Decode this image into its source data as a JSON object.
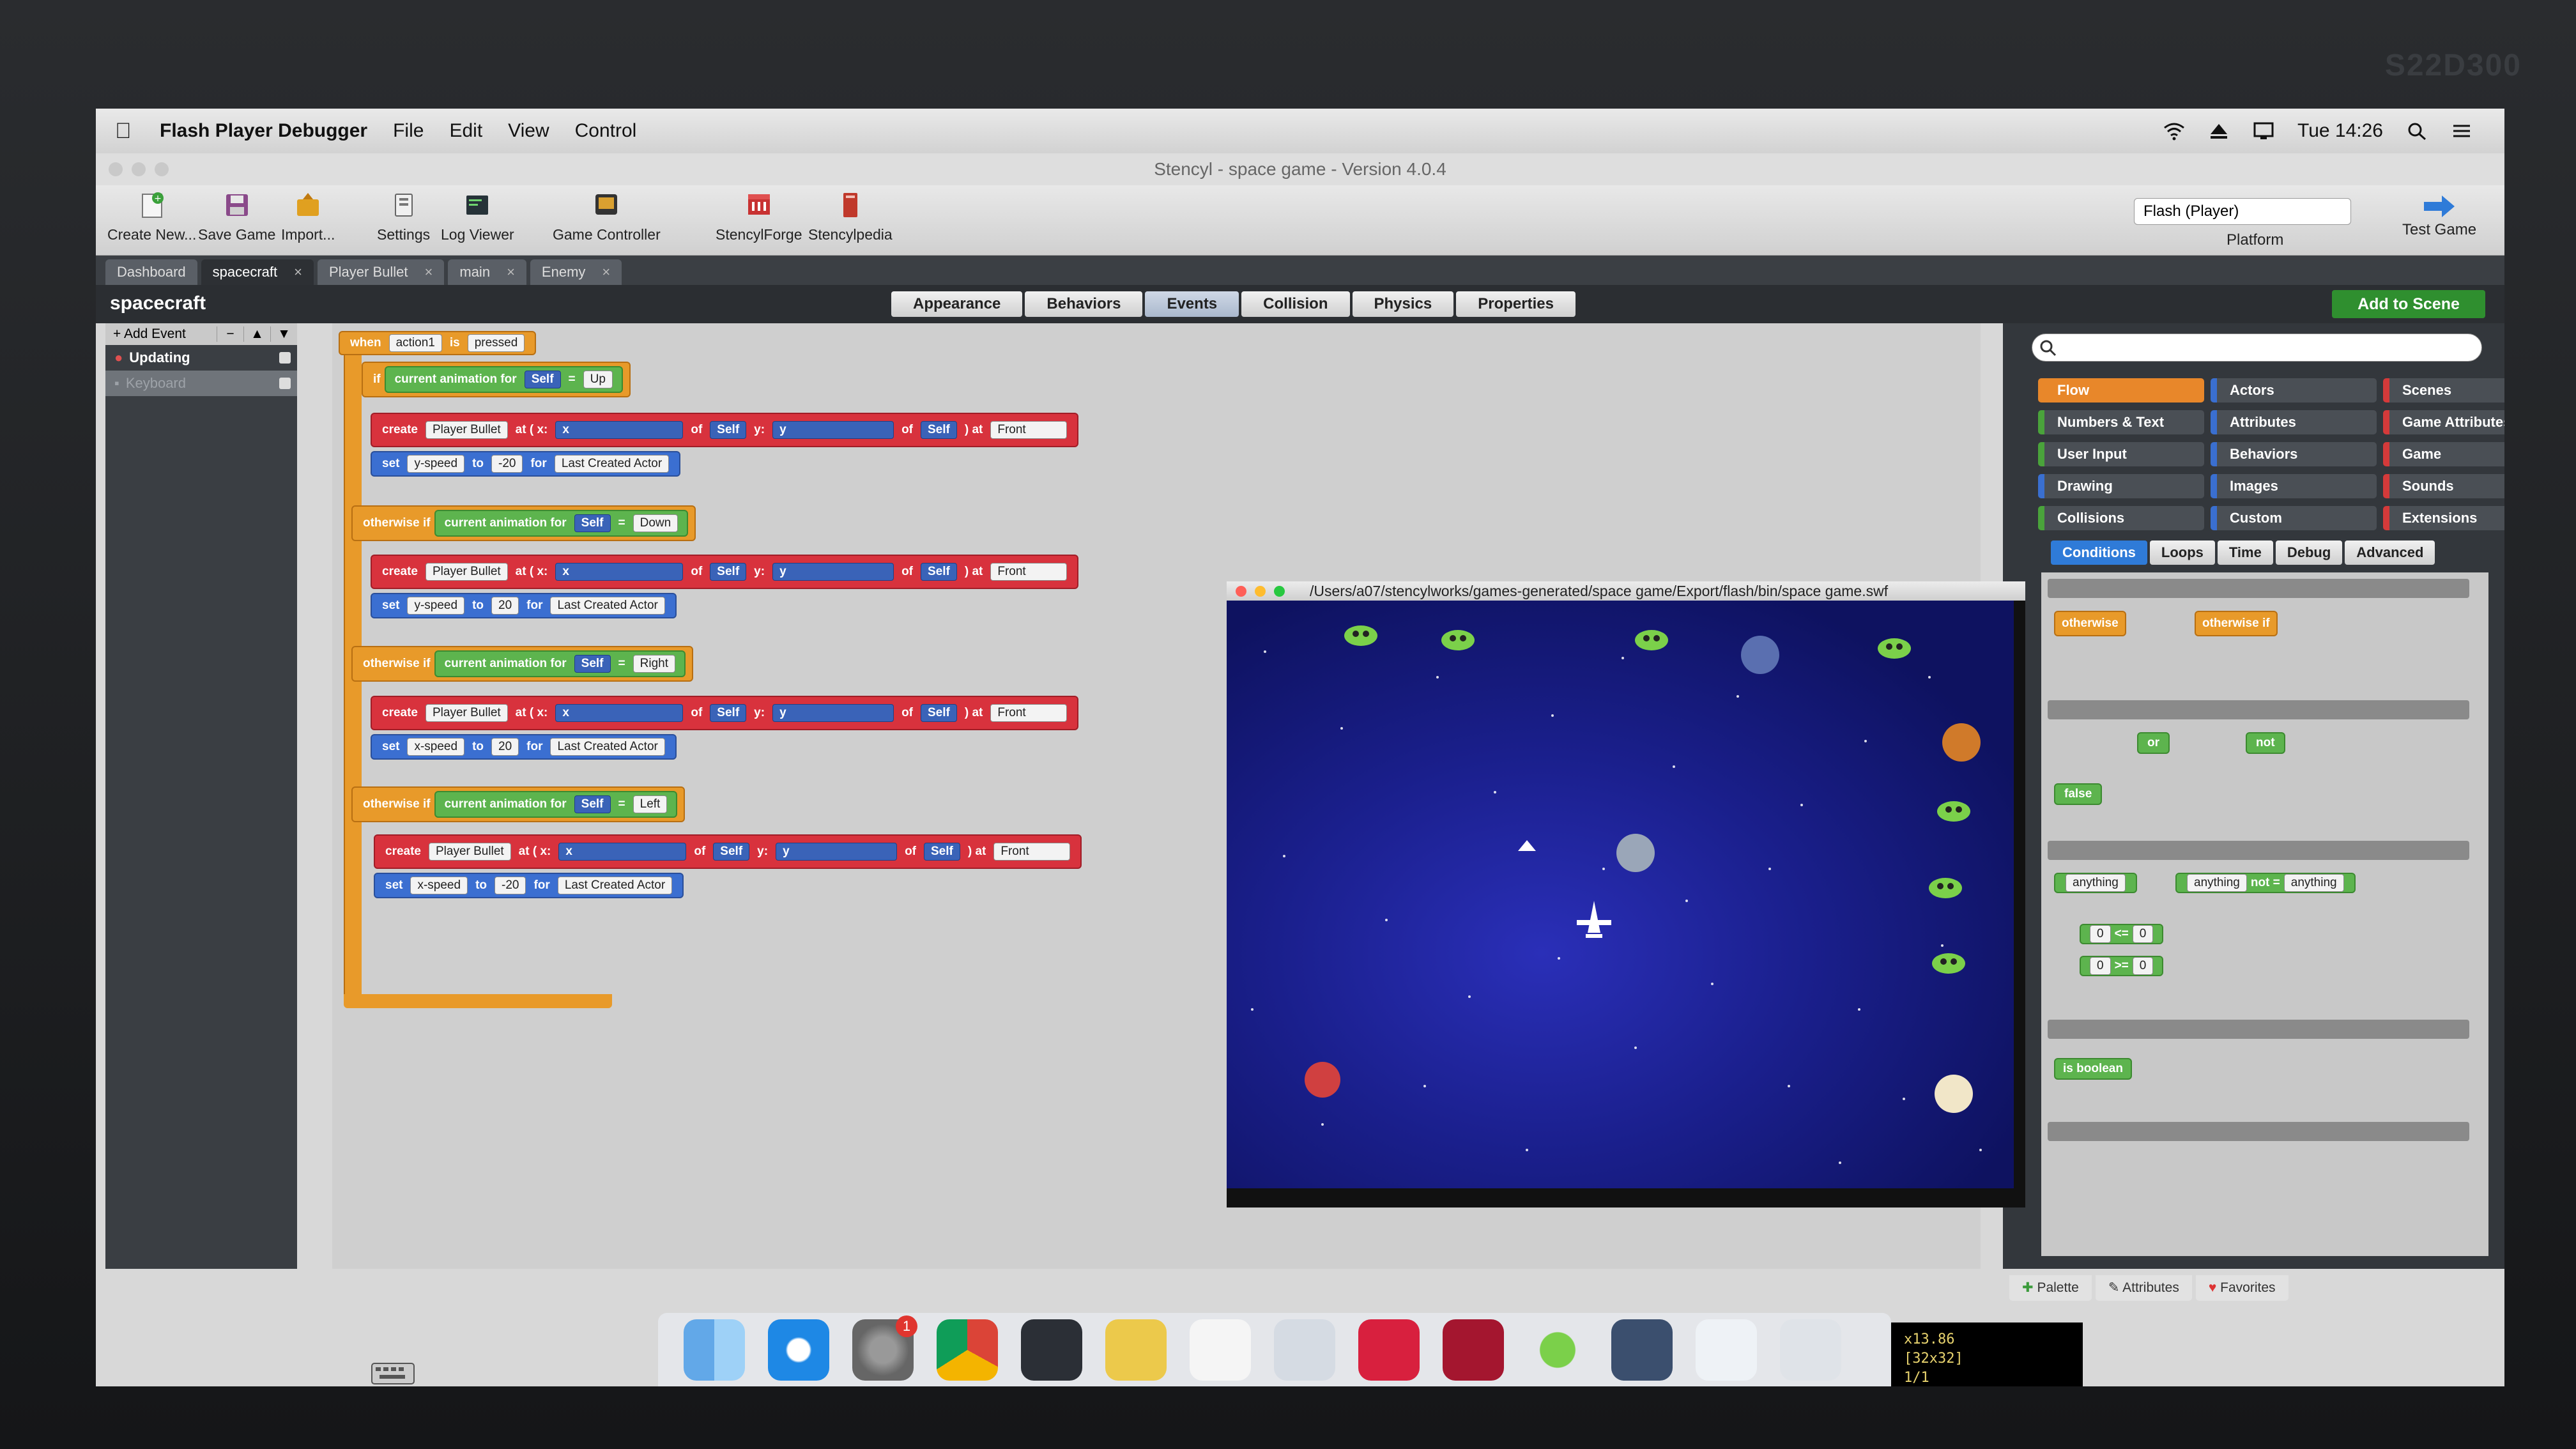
{
  "menubar": {
    "app_name": "Flash Player Debugger",
    "menus": [
      "File",
      "Edit",
      "View",
      "Control"
    ],
    "clock": "Tue 14:26"
  },
  "window": {
    "title": "Stencyl - space game - Version 4.0.4"
  },
  "toolbar": {
    "buttons": [
      {
        "label": "Create New...",
        "icon": "create-new-icon"
      },
      {
        "label": "Save Game",
        "icon": "save-icon"
      },
      {
        "label": "Import...",
        "icon": "import-icon"
      },
      {
        "label": "Settings",
        "icon": "settings-icon"
      },
      {
        "label": "Log Viewer",
        "icon": "log-viewer-icon"
      },
      {
        "label": "Game Controller",
        "icon": "game-controller-icon"
      },
      {
        "label": "StencylForge",
        "icon": "stencylforge-icon"
      },
      {
        "label": "Stencylpedia",
        "icon": "stencylpedia-icon"
      }
    ],
    "platform_value": "Flash (Player)",
    "platform_label": "Platform",
    "test_game": "Test Game"
  },
  "tabs": [
    {
      "label": "Dashboard",
      "closable": false
    },
    {
      "label": "spacecraft",
      "closable": true,
      "active": true
    },
    {
      "label": "Player Bullet",
      "closable": true
    },
    {
      "label": "main",
      "closable": true
    },
    {
      "label": "Enemy",
      "closable": true
    }
  ],
  "editor": {
    "title": "spacecraft",
    "mode_tabs": [
      "Appearance",
      "Behaviors",
      "Events",
      "Collision",
      "Physics",
      "Properties"
    ],
    "active_mode": "Events",
    "add_to_scene": "Add to Scene"
  },
  "events_panel": {
    "add_event": "+ Add Event",
    "items": [
      {
        "label": "Updating"
      },
      {
        "label": "Keyboard"
      }
    ]
  },
  "blocks": {
    "when": "when",
    "action": "action1",
    "is": "is",
    "pressed": "pressed",
    "if": "if",
    "otherwise_if": "otherwise if",
    "current_animation_for": "current animation for",
    "self": "Self",
    "eq": "=",
    "create": "create",
    "player_bullet": "Player Bullet",
    "at_x": "at ( x:",
    "x": "x",
    "of": "of",
    "y_colon": "y:",
    "y": "y",
    "at_front": ") at",
    "front": "Front",
    "set": "set",
    "to": "to",
    "for": "for",
    "last_created_actor": "Last Created Actor",
    "y_speed": "y-speed",
    "x_speed": "x-speed",
    "branches": [
      {
        "anim": "Up",
        "speed_prop": "y-speed",
        "speed": "-20"
      },
      {
        "anim": "Down",
        "speed_prop": "y-speed",
        "speed": "20"
      },
      {
        "anim": "Right",
        "speed_prop": "x-speed",
        "speed": "20"
      },
      {
        "anim": "Left",
        "speed_prop": "x-speed",
        "speed": "-20"
      }
    ]
  },
  "game_window": {
    "path": "/Users/a07/stencylworks/games-generated/space game/Export/flash/bin/space game.swf"
  },
  "palette": {
    "categories": [
      {
        "label": "Flow",
        "color": "#e8872a"
      },
      {
        "label": "Actors",
        "color": "#3a6fd0"
      },
      {
        "label": "Scenes",
        "color": "#d43a3a"
      },
      {
        "label": "Numbers & Text",
        "color": "#4aa33b"
      },
      {
        "label": "Attributes",
        "color": "#3a6fd0"
      },
      {
        "label": "Game Attributes",
        "color": "#d43a3a"
      },
      {
        "label": "User Input",
        "color": "#4aa33b"
      },
      {
        "label": "Behaviors",
        "color": "#3a6fd0"
      },
      {
        "label": "Game",
        "color": "#d43a3a"
      },
      {
        "label": "Drawing",
        "color": "#3a6fd0"
      },
      {
        "label": "Images",
        "color": "#3a6fd0"
      },
      {
        "label": "Sounds",
        "color": "#d43a3a"
      },
      {
        "label": "Collisions",
        "color": "#4aa33b"
      },
      {
        "label": "Custom",
        "color": "#3a6fd0"
      },
      {
        "label": "Extensions",
        "color": "#d43a3a"
      }
    ],
    "sub_tabs": [
      "Conditions",
      "Loops",
      "Time",
      "Debug",
      "Advanced"
    ],
    "active_sub_tab": "Conditions",
    "blocks": {
      "otherwise": "otherwise",
      "otherwise_if": "otherwise if",
      "or": "or",
      "not": "not",
      "false": "false",
      "anything": "anything",
      "not_eq": "not =",
      "zero": "0",
      "lte": "<=",
      "gte": ">=",
      "boolean": "is boolean"
    },
    "bottom_tabs": [
      "Palette",
      "Attributes",
      "Favorites"
    ]
  },
  "status_readout": {
    "line1": "x13.86",
    "line2": "[32x32]",
    "line3": "1/1"
  },
  "dock_badge": "1",
  "monitor_brand": "S22D300"
}
